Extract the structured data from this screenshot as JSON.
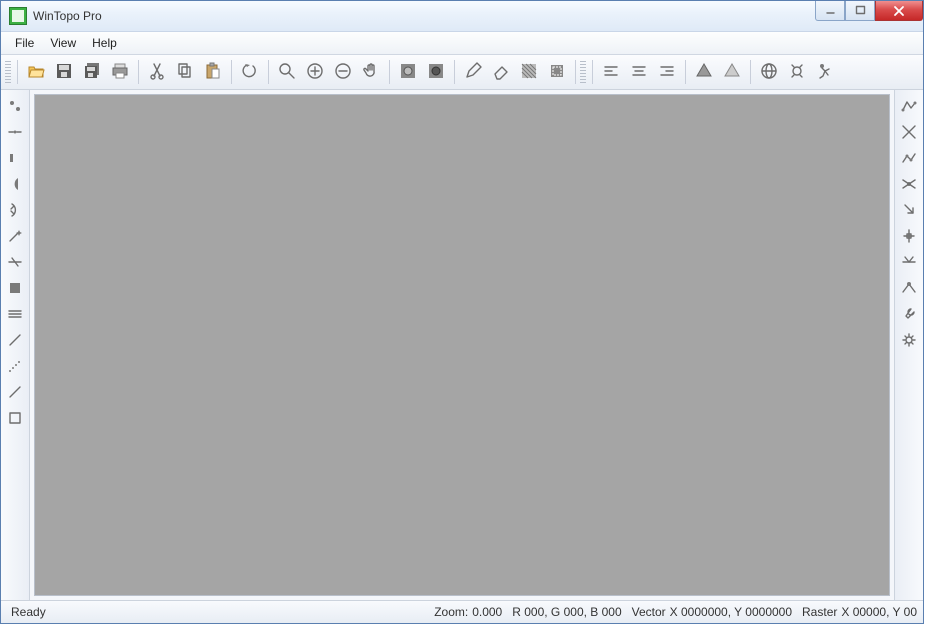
{
  "window": {
    "title": "WinTopo Pro"
  },
  "menu": {
    "items": [
      {
        "label": "File"
      },
      {
        "label": "View"
      },
      {
        "label": "Help"
      }
    ]
  },
  "toolbar": {
    "buttons": [
      "open-icon",
      "save-icon",
      "save-all-icon",
      "print-icon",
      "|",
      "cut-icon",
      "copy-icon",
      "paste-icon",
      "|",
      "undo-icon",
      "|",
      "zoom-icon",
      "zoom-in-icon",
      "zoom-out-icon",
      "pan-icon",
      "|",
      "target-1-icon",
      "target-2-icon",
      "|",
      "pencil-icon",
      "eraser-icon",
      "fill-area-icon",
      "crop-icon",
      "|",
      "align-left-icon",
      "align-center-icon",
      "align-right-icon",
      "|",
      "layer-1-icon",
      "layer-2-icon",
      "|",
      "globe-icon",
      "config-icon",
      "run-icon"
    ]
  },
  "left_tools": [
    "point-tool-icon",
    "snap-tool-icon",
    "line-seg-icon",
    "arc-left-icon",
    "arc-right-icon",
    "magic-wand-icon",
    "cross-icon",
    "rect-fill-icon",
    "lines-icon",
    "thin-pencil-icon",
    "dots-icon",
    "brush-icon",
    "rect-outline-icon"
  ],
  "right_tools": [
    "polyline-icon",
    "crossline-icon",
    "edit-line-icon",
    "spider-icon",
    "arrow-down-icon",
    "anchor-icon",
    "node-k-icon",
    "anchor-dot-icon",
    "wrench-icon",
    "gear-small-icon"
  ],
  "statusbar": {
    "ready": "Ready",
    "zoom_label": "Zoom:",
    "zoom_value": "0.000",
    "rgb": "R 000, G 000, B 000",
    "vector_label": "Vector",
    "vector_value": "X 0000000, Y 0000000",
    "raster_label": "Raster",
    "raster_value": "X 00000, Y 00"
  }
}
